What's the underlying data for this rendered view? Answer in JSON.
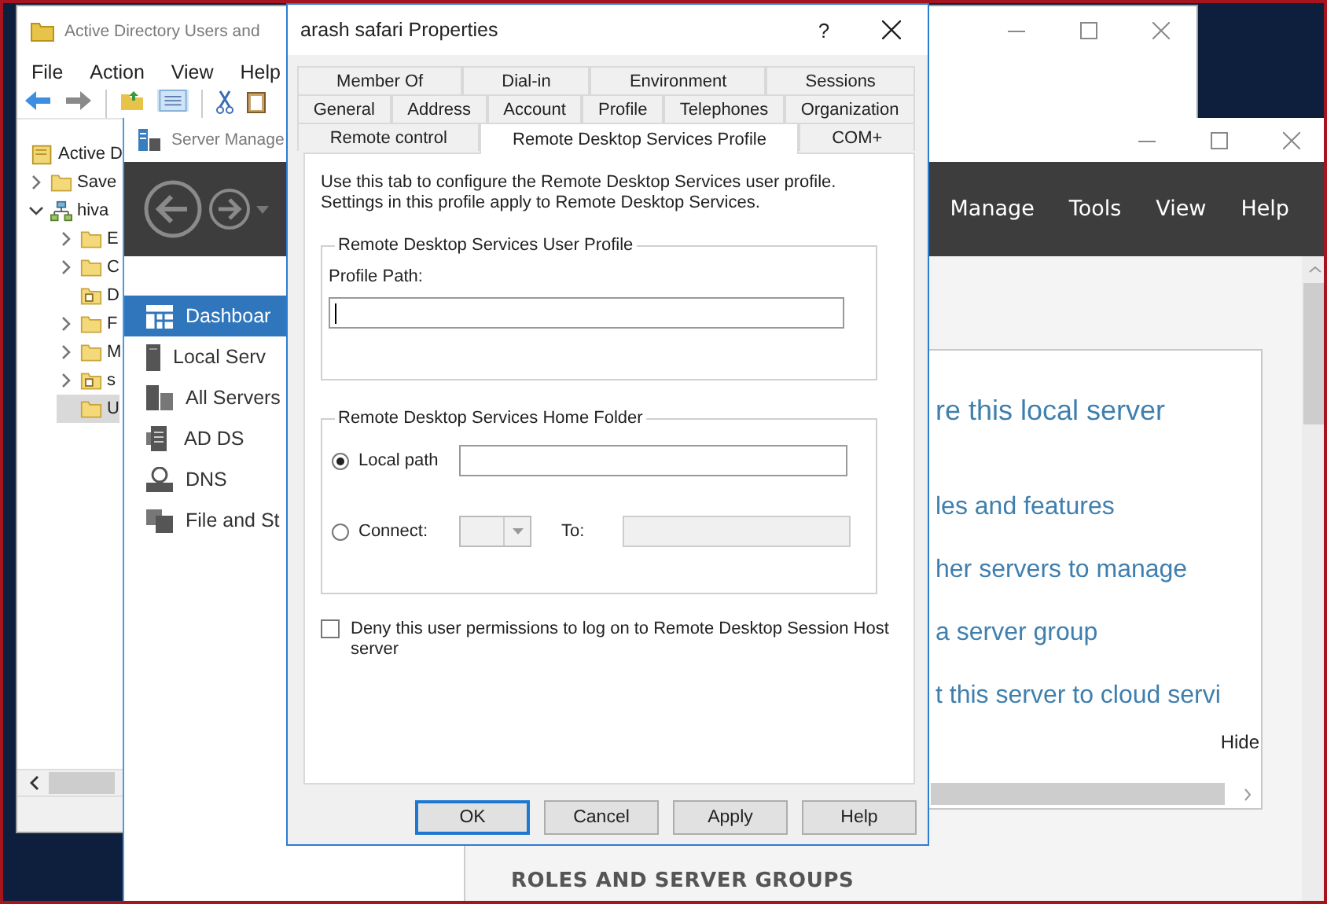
{
  "ad_window": {
    "title": "Active Directory Users and",
    "menu": [
      "File",
      "Action",
      "View",
      "Help"
    ],
    "tree": [
      {
        "label": "Active D",
        "kind": "root",
        "selected": false,
        "children": [
          {
            "label": "Save",
            "kind": "folder",
            "expanded": false,
            "selected": false
          },
          {
            "label": "hiva",
            "kind": "domain",
            "expanded": true,
            "selected": false,
            "children": [
              {
                "label": "E",
                "kind": "folder",
                "expanded": false,
                "selected": false
              },
              {
                "label": "C",
                "kind": "folder",
                "expanded": false,
                "selected": false
              },
              {
                "label": "D",
                "kind": "ou",
                "selected": false
              },
              {
                "label": "F",
                "kind": "folder",
                "expanded": false,
                "selected": false
              },
              {
                "label": "M",
                "kind": "folder",
                "expanded": false,
                "selected": false
              },
              {
                "label": "s",
                "kind": "ou",
                "expanded": false,
                "selected": false
              },
              {
                "label": "U",
                "kind": "folder",
                "selected": true
              }
            ]
          }
        ]
      }
    ]
  },
  "server_manager": {
    "title": "Server Manage",
    "menu": [
      "Manage",
      "Tools",
      "View",
      "Help"
    ],
    "nav": [
      {
        "label": "Dashboar",
        "kind": "dashboard",
        "selected": true
      },
      {
        "label": "Local Serv",
        "kind": "server",
        "selected": false
      },
      {
        "label": "All Servers",
        "kind": "servers",
        "selected": false
      },
      {
        "label": "AD DS",
        "kind": "adds",
        "selected": false
      },
      {
        "label": "DNS",
        "kind": "dns",
        "selected": false
      },
      {
        "label": "File and St",
        "kind": "files",
        "selected": false
      }
    ],
    "welcome_links": [
      "re this local server",
      "les and features",
      "her servers to manage",
      "a server group",
      "t this server to cloud servi"
    ],
    "hide": "Hide",
    "section_heading": "ROLES AND SERVER GROUPS"
  },
  "dialog": {
    "title": "arash safari Properties",
    "help": "?",
    "tab_rows": [
      [
        {
          "label": "Member Of",
          "selected": false
        },
        {
          "label": "Dial-in",
          "selected": false
        },
        {
          "label": "Environment",
          "selected": false
        },
        {
          "label": "Sessions",
          "selected": false
        }
      ],
      [
        {
          "label": "General",
          "selected": false
        },
        {
          "label": "Address",
          "selected": false
        },
        {
          "label": "Account",
          "selected": false
        },
        {
          "label": "Profile",
          "selected": false
        },
        {
          "label": "Telephones",
          "selected": false
        },
        {
          "label": "Organization",
          "selected": false
        }
      ],
      [
        {
          "label": "Remote control",
          "selected": false
        },
        {
          "label": "Remote Desktop Services Profile",
          "selected": true
        },
        {
          "label": "COM+",
          "selected": false
        }
      ]
    ],
    "description": [
      "Use this tab to configure the Remote Desktop Services user profile.",
      "Settings in this profile apply to Remote Desktop Services."
    ],
    "user_profile": {
      "title": "Remote Desktop Services User Profile",
      "path_label": "Profile Path:",
      "focused": true
    },
    "home_folder": {
      "title": "Remote Desktop Services Home Folder",
      "options": [
        {
          "label": "Local path",
          "kind": "path",
          "selected": true
        },
        {
          "label": "Connect:",
          "kind": "drive",
          "selected": false
        }
      ],
      "to_label": "To:"
    },
    "deny": {
      "label": "Deny this user permissions to log on to Remote Desktop Session Host server",
      "checked": false
    },
    "buttons": [
      {
        "label": "OK",
        "default": true
      },
      {
        "label": "Cancel",
        "default": false
      },
      {
        "label": "Apply",
        "default": false
      },
      {
        "label": "Help",
        "default": false
      }
    ]
  }
}
